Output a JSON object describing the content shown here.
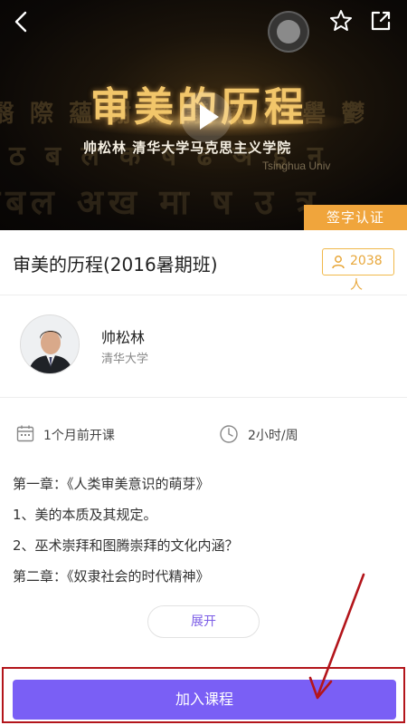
{
  "video": {
    "cover_title": "审美的历程",
    "cover_subtitle": "帅松林 清华大学马克思主义学院",
    "cover_university": "Tsinghua Univ",
    "sign_badge": "签字认证"
  },
  "course": {
    "title": "审美的历程(2016暑期班)",
    "enrolled": "2038人"
  },
  "teacher": {
    "name": "帅松林",
    "school": "清华大学"
  },
  "meta": {
    "start": "1个月前开课",
    "hours": "2小时/周"
  },
  "syllabus": [
    "第一章：《人类审美意识的萌芽》",
    "1、美的本质及其规定。",
    "2、巫术崇拜和图腾崇拜的文化内涵？",
    "第二章：《奴隶社会的时代精神》"
  ],
  "expand_label": "展开",
  "join_label": "加入课程",
  "colors": {
    "accent": "#7a5ff5",
    "badge_orange": "#f0a53c",
    "highlight_red": "#b3151b"
  }
}
